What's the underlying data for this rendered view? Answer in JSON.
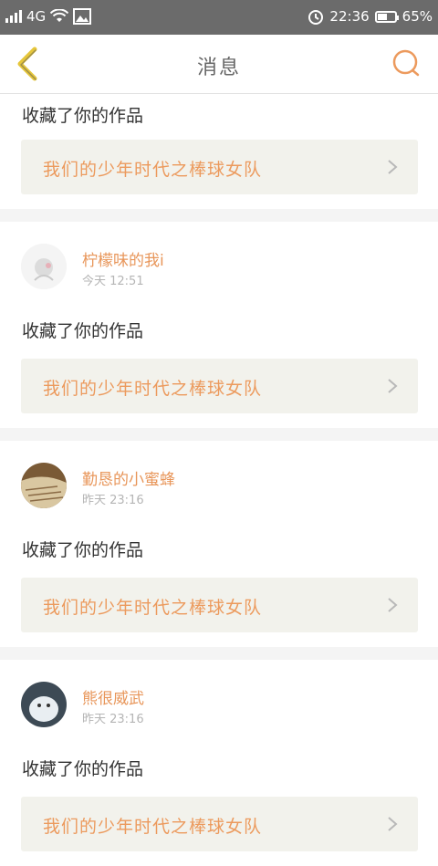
{
  "status": {
    "network": "4G",
    "time": "22:36",
    "battery": "65%",
    "battery_level": 0.65
  },
  "header": {
    "title": "消息"
  },
  "messages": [
    {
      "action": "收藏了你的作品",
      "work_title": "我们的少年时代之棒球女队"
    },
    {
      "username": "柠檬味的我i",
      "time": "今天 12:51",
      "action": "收藏了你的作品",
      "work_title": "我们的少年时代之棒球女队"
    },
    {
      "username": "勤恳的小蜜蜂",
      "time": "昨天 23:16",
      "action": "收藏了你的作品",
      "work_title": "我们的少年时代之棒球女队"
    },
    {
      "username": "熊很威武",
      "time": "昨天 23:16",
      "action": "收藏了你的作品",
      "work_title": "我们的少年时代之棒球女队"
    }
  ],
  "colors": {
    "accent": "#ec9a5d",
    "back_arrow": "#e6c63a",
    "status_bar": "#6b6b6b"
  },
  "icons": {
    "back": "chevron-left-icon",
    "search": "search-icon",
    "chevron": "chevron-right-icon"
  }
}
